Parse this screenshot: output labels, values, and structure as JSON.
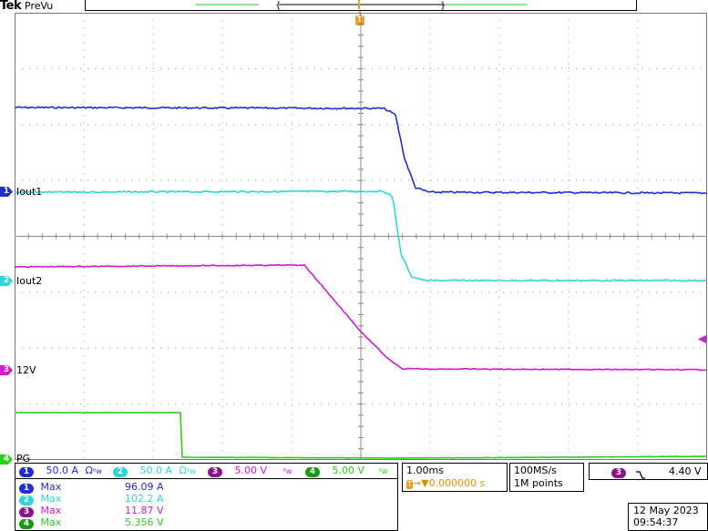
{
  "header": {
    "brand": "Tek",
    "acq_status": "PreVu"
  },
  "trigger_marker": {
    "label": "T"
  },
  "channels": [
    {
      "id": "1",
      "label": "Iout1",
      "color": "#1f2fd0"
    },
    {
      "id": "2",
      "label": "Iout2",
      "color": "#2fd6d6"
    },
    {
      "id": "3",
      "label": "12V",
      "color": "#d21ad2"
    },
    {
      "id": "4",
      "label": "PG",
      "color": "#2ccf1c"
    }
  ],
  "vertical_settings": [
    {
      "ch": "1",
      "scale": "50.0 A",
      "coupling": "Ω",
      "bw": "ᴮw",
      "color": "#1f2fd0"
    },
    {
      "ch": "2",
      "scale": "50.0 A",
      "coupling": "Ω",
      "bw": "ᴮw",
      "color": "#2fd6d6"
    },
    {
      "ch": "3",
      "scale": "5.00 V",
      "coupling": "",
      "bw": "ᴮw",
      "color": "#d21ad2"
    },
    {
      "ch": "4",
      "scale": "5.00 V",
      "coupling": "",
      "bw": "ᴮw",
      "color": "#2ccf1c"
    }
  ],
  "measurements": [
    {
      "ch": "1",
      "type": "Max",
      "value": "96.09 A",
      "color": "#1f2fd0"
    },
    {
      "ch": "2",
      "type": "Max",
      "value": "102.2 A",
      "color": "#2fd6d6"
    },
    {
      "ch": "3",
      "type": "Max",
      "value": "11.87 V",
      "color": "#d21ad2"
    },
    {
      "ch": "4",
      "type": "Max",
      "value": "5.356 V",
      "color": "#2ccf1c"
    }
  ],
  "timebase": {
    "scale": "1.00ms",
    "position": "0.000000 s"
  },
  "acquisition": {
    "rate": "100MS/s",
    "record": "1M points"
  },
  "trigger": {
    "ch": "3",
    "slope": "falling",
    "level": "4.40 V"
  },
  "datetime": {
    "date": "12 May 2023",
    "time": "09:54:37"
  },
  "colors": {
    "grid": "#9a9a9a",
    "trigger": "#f0a020",
    "timebase_text": "#e09000"
  }
}
